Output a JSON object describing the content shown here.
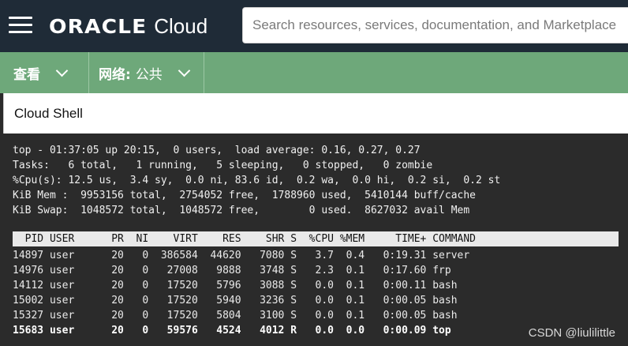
{
  "topbar": {
    "brand_oracle": "ORACLE",
    "brand_cloud": "Cloud",
    "search_placeholder": "Search resources, services, documentation, and Marketplace"
  },
  "toolbar": {
    "view_label": "查看",
    "network_label": "网络:",
    "network_value": "公共"
  },
  "shell": {
    "title": "Cloud Shell"
  },
  "terminal": {
    "summary": [
      "top - 01:37:05 up 20:15,  0 users,  load average: 0.16, 0.27, 0.27",
      "Tasks:   6 total,   1 running,   5 sleeping,   0 stopped,   0 zombie",
      "%Cpu(s): 12.5 us,  3.4 sy,  0.0 ni, 83.6 id,  0.2 wa,  0.0 hi,  0.2 si,  0.2 st",
      "KiB Mem :  9953156 total,  2754052 free,  1788960 used,  5410144 buff/cache",
      "KiB Swap:  1048572 total,  1048572 free,        0 used.  8627032 avail Mem"
    ],
    "header": "  PID USER      PR  NI    VIRT    RES    SHR S  %CPU %MEM     TIME+ COMMAND",
    "rows": [
      "14897 user      20   0  386584  44620   7080 S   3.7  0.4   0:19.31 server",
      "14976 user      20   0   27008   9888   3748 S   2.3  0.1   0:17.60 frp",
      "14112 user      20   0   17520   5796   3088 S   0.0  0.1   0:00.11 bash",
      "15002 user      20   0   17520   5940   3236 S   0.0  0.1   0:00.05 bash",
      "15327 user      20   0   17520   5804   3100 S   0.0  0.1   0:00.05 bash",
      "15683 user      20   0   59576   4524   4012 R   0.0  0.0   0:00.09 top"
    ]
  },
  "watermark": "CSDN @liulilittle"
}
